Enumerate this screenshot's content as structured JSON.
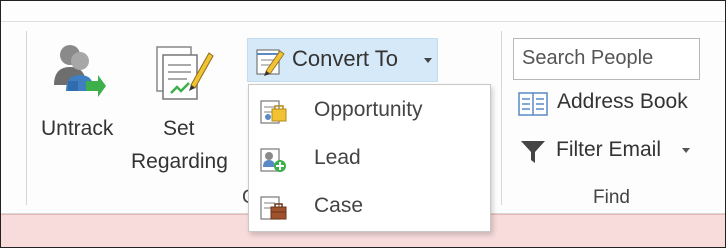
{
  "ribbon": {
    "untrack": {
      "label": "Untrack",
      "icon": "untrack-icon"
    },
    "set_regarding": {
      "label_line1": "Set",
      "label_line2": "Regarding",
      "icon": "set-regarding-icon"
    },
    "convert_to": {
      "label": "Convert To",
      "icon": "convert-to-icon"
    },
    "group_label_partial": "C",
    "search_people": {
      "placeholder": "Search People"
    },
    "address_book": {
      "label": "Address Book",
      "icon": "address-book-icon"
    },
    "filter_email": {
      "label": "Filter Email",
      "icon": "filter-icon"
    },
    "find_group_label": "Find"
  },
  "convert_menu": {
    "items": [
      {
        "label": "Opportunity",
        "icon": "opportunity-icon"
      },
      {
        "label": "Lead",
        "icon": "lead-icon"
      },
      {
        "label": "Case",
        "icon": "case-icon"
      }
    ]
  },
  "colors": {
    "hover_blue": "#d5e9f8",
    "status_pink": "#f8dcdc"
  }
}
